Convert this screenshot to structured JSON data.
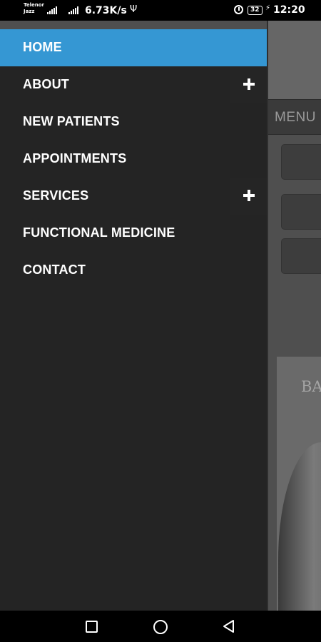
{
  "status_bar": {
    "carrier_line1": "Telenor",
    "carrier_line2": "Jazz",
    "net_speed": "6.73K/s",
    "battery": "32",
    "time": "12:20"
  },
  "background": {
    "menu_label": "MENU",
    "image_text": "BA"
  },
  "drawer": {
    "accent_color": "#3597d3",
    "items": [
      {
        "label": "HOME",
        "active": true,
        "expandable": false
      },
      {
        "label": "ABOUT",
        "active": false,
        "expandable": true
      },
      {
        "label": "NEW PATIENTS",
        "active": false,
        "expandable": false
      },
      {
        "label": "APPOINTMENTS",
        "active": false,
        "expandable": false
      },
      {
        "label": "SERVICES",
        "active": false,
        "expandable": true
      },
      {
        "label": "FUNCTIONAL MEDICINE",
        "active": false,
        "expandable": false
      },
      {
        "label": "CONTACT",
        "active": false,
        "expandable": false
      }
    ]
  },
  "icons": {
    "recents": "square-icon",
    "home": "circle-icon",
    "back": "triangle-icon",
    "expand": "plus-icon"
  }
}
